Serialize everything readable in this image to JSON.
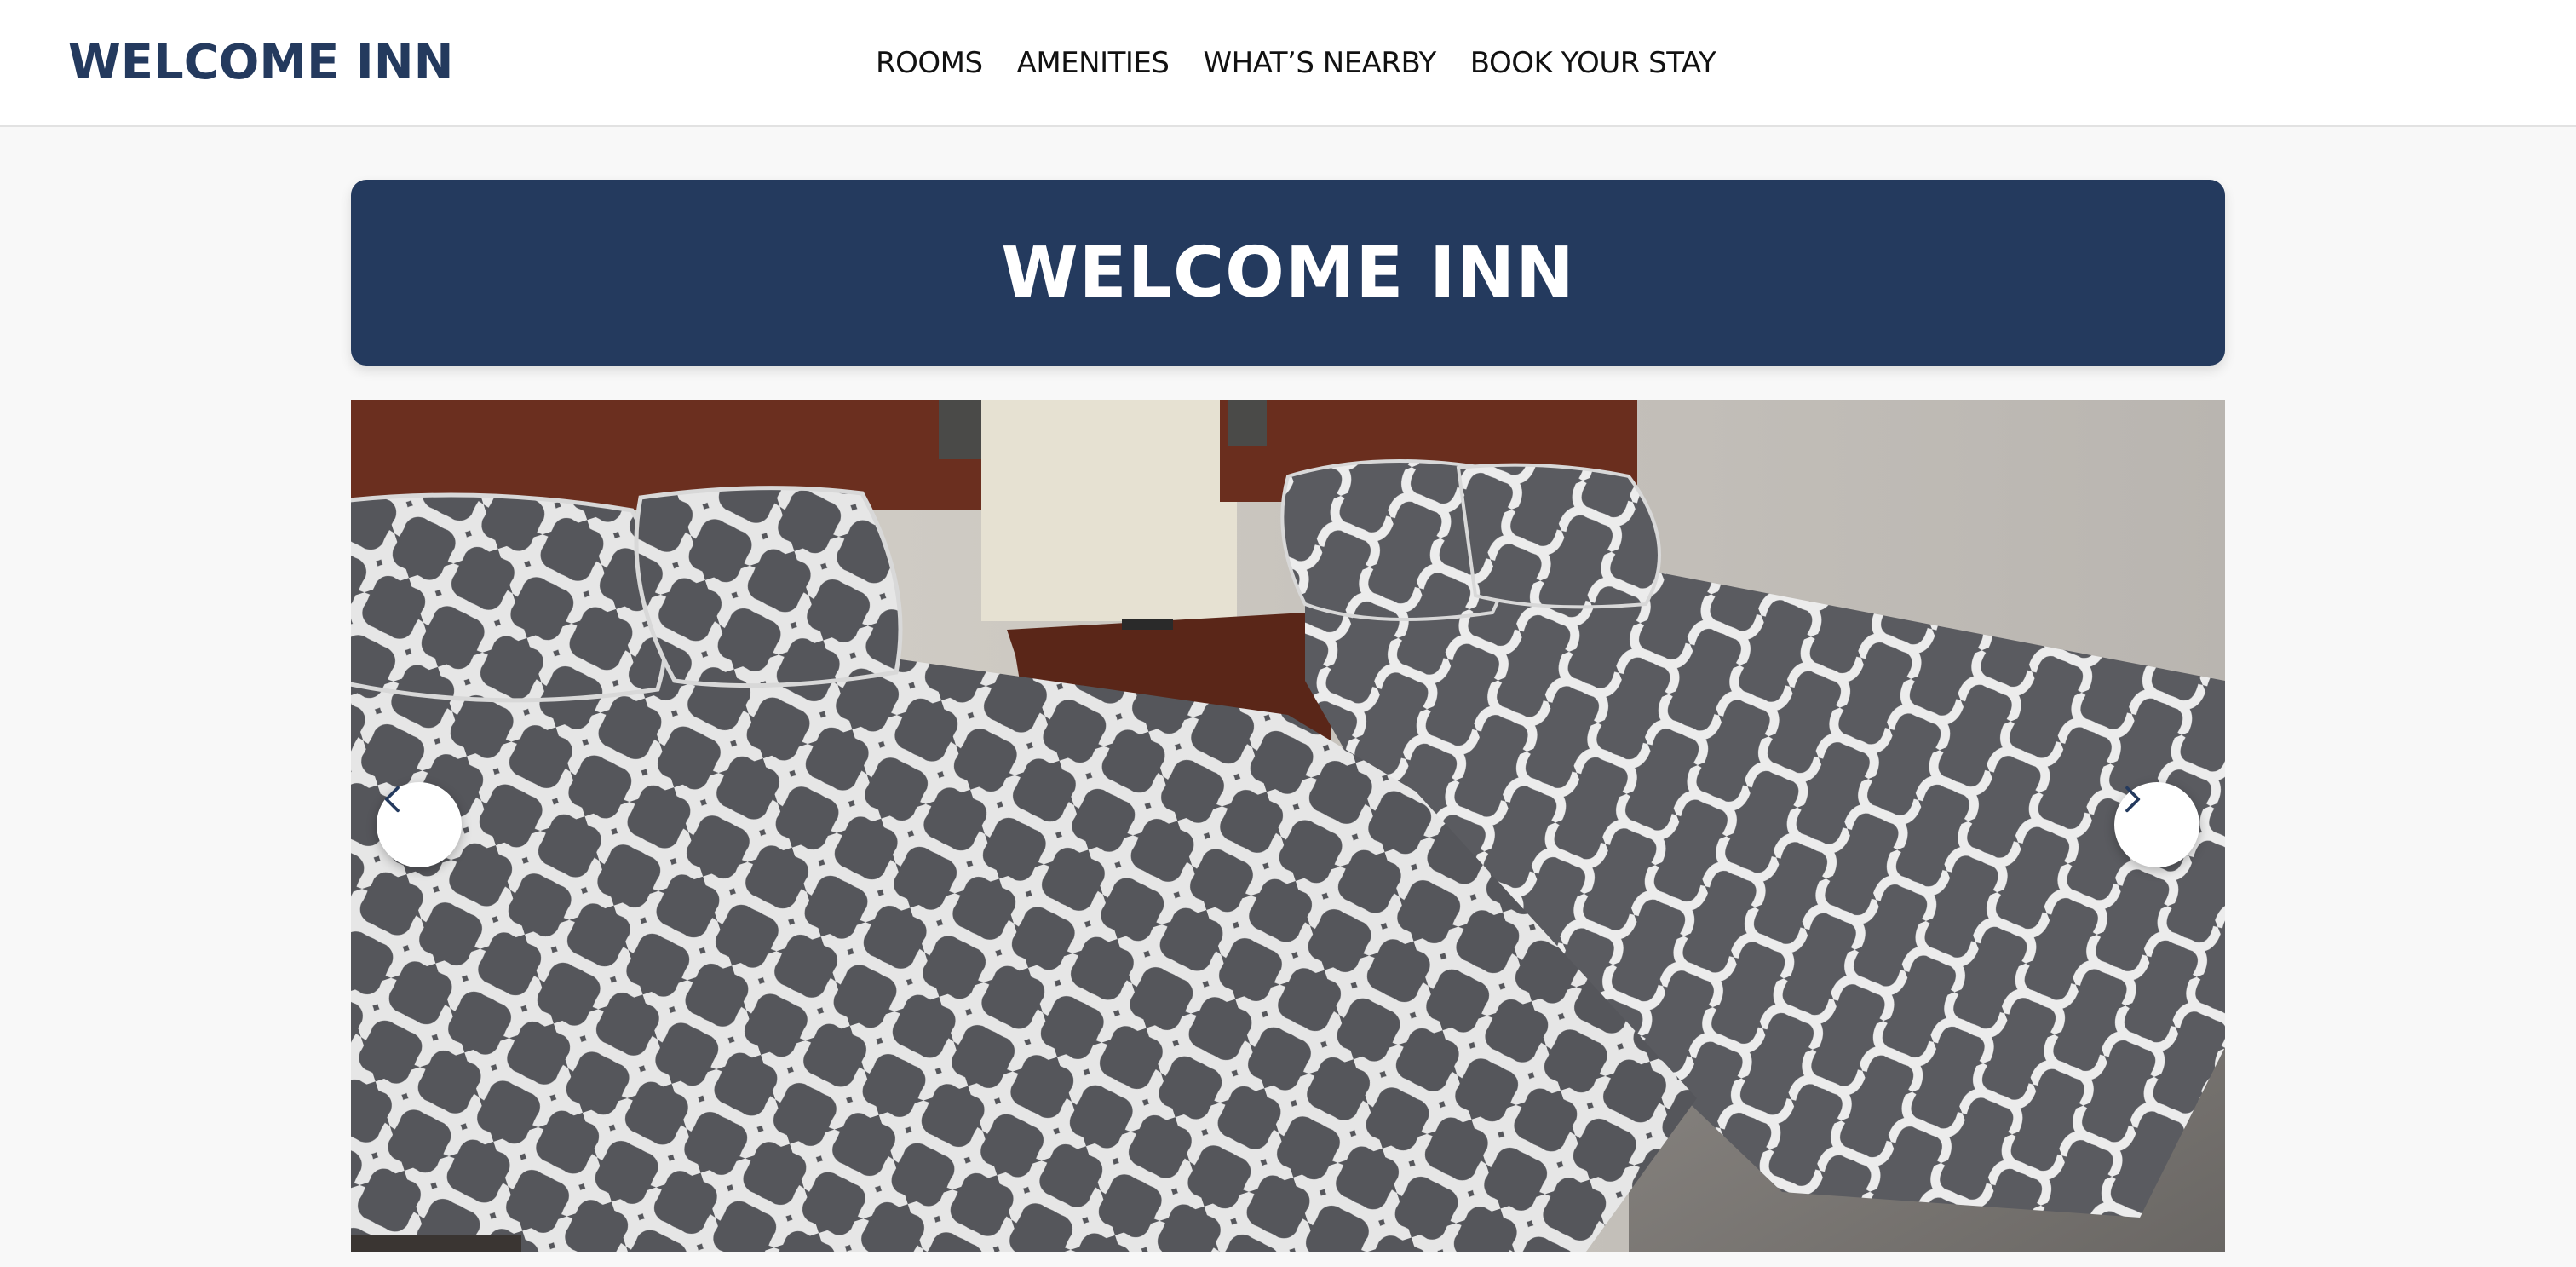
{
  "header": {
    "brand": "WELCOME INN",
    "nav": [
      {
        "label": "ROOMS"
      },
      {
        "label": "AMENITIES"
      },
      {
        "label": "WHAT’S NEARBY"
      },
      {
        "label": "BOOK YOUR STAY"
      }
    ]
  },
  "hero": {
    "title": "WELCOME INN"
  },
  "carousel": {
    "prev_icon": "chevron-left-icon",
    "next_icon": "chevron-right-icon"
  },
  "colors": {
    "brand_navy": "#243a5e",
    "background": "#f8f8f8"
  }
}
